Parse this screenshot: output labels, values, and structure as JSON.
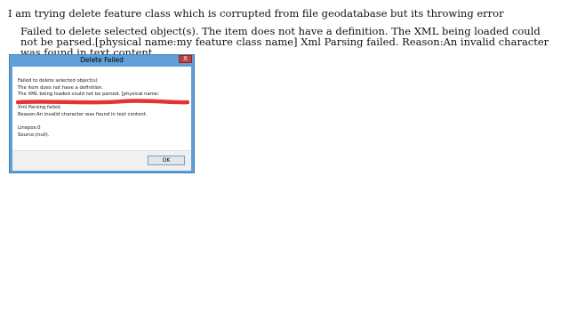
{
  "question": "I am trying delete feature class which is corrupted from file geodatabase but its throwing error",
  "quote": "Failed to delete selected object(s). The item does not have a definition. The XML being loaded could not be parsed.[physical name:my feature class name] Xml Parsing failed. Reason:An invalid character was found in text content.",
  "dialog": {
    "title": "Delete Failed",
    "close_label": "X",
    "message_lines": [
      "Failed to delete selected object(s)",
      "The item does not have a definition.",
      "The XML being loaded could not be parsed. [physical name:",
      "Xml Parsing failed.",
      "Reason:An invalid character was found in text content.",
      "Linepos:0",
      "Source:(null)."
    ],
    "ok_label": "OK",
    "redaction_color": "#e8322e"
  }
}
